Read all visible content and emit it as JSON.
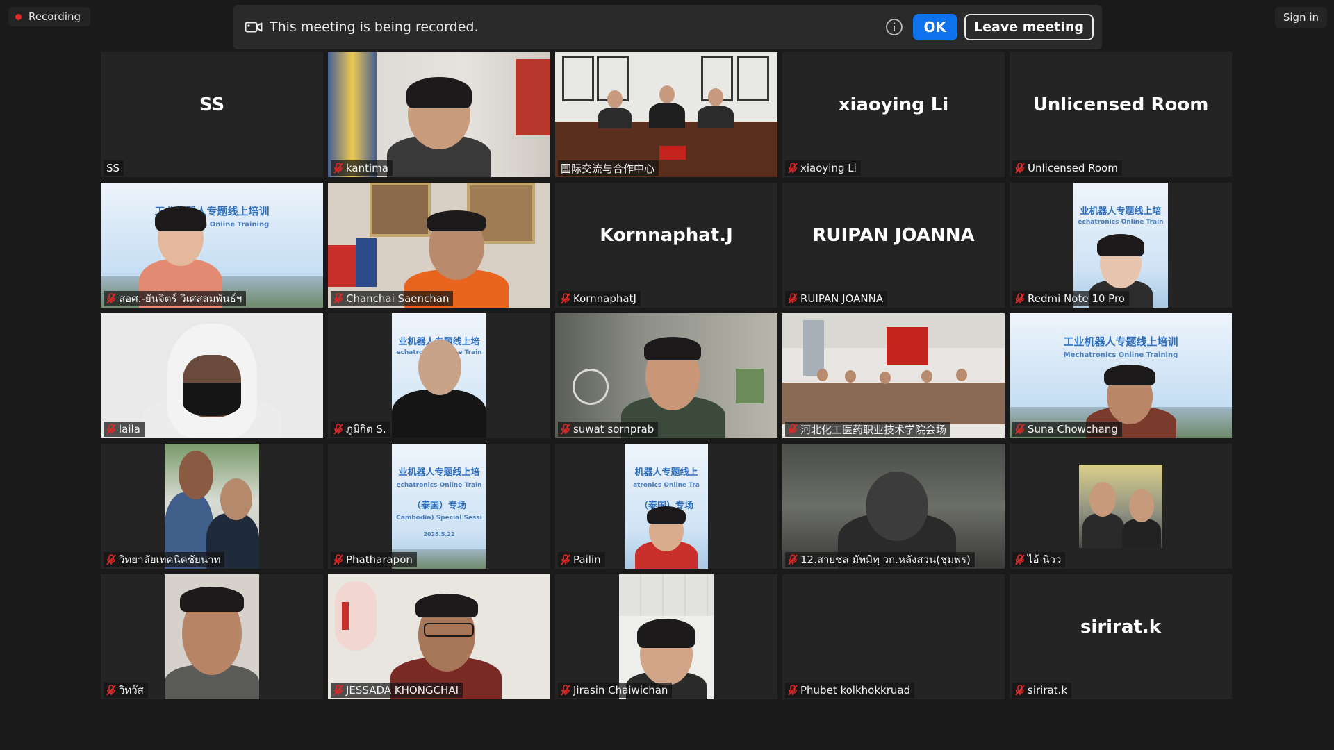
{
  "recording_badge": {
    "label": "Recording",
    "color": "#e02828"
  },
  "sign_in": {
    "label": "Sign in"
  },
  "banner": {
    "message": "This meeting is being recorded.",
    "ok_label": "OK",
    "leave_label": "Leave meeting",
    "ok_color": "#0e72ed"
  },
  "active_speaker_color": "#d6e35b",
  "participants": [
    {
      "name": "SS",
      "initials": "SS",
      "video": false,
      "muted": false
    },
    {
      "name": "kantima",
      "video": true,
      "muted": true
    },
    {
      "name": "国际交流与合作中心",
      "video": true,
      "muted": false,
      "active": true
    },
    {
      "name": "xiaoying Li",
      "initials": "xiaoying Li",
      "video": false,
      "muted": true
    },
    {
      "name": "Unlicensed Room",
      "initials": "Unlicensed Room",
      "video": false,
      "muted": true
    },
    {
      "name": "สอศ.-ยันจิตร์ วิเศสสมพันธ์ฯ",
      "video": true,
      "muted": true
    },
    {
      "name": "Chanchai Saenchan",
      "video": true,
      "muted": true
    },
    {
      "name": "KornnaphatJ",
      "initials": "Kornnaphat.J",
      "video": false,
      "muted": true
    },
    {
      "name": "RUIPAN JOANNA",
      "initials": "RUIPAN JOANNA",
      "video": false,
      "muted": true
    },
    {
      "name": "Redmi Note 10 Pro",
      "video": true,
      "muted": true
    },
    {
      "name": "laila",
      "video": true,
      "muted": true
    },
    {
      "name": "ภูมิกิต S.",
      "video": true,
      "muted": true
    },
    {
      "name": "suwat sornprab",
      "video": true,
      "muted": true
    },
    {
      "name": "河北化工医药职业技术学院会场",
      "video": true,
      "muted": true
    },
    {
      "name": "Suna Chowchang",
      "video": true,
      "muted": true
    },
    {
      "name": "วิทยาลัยเทคนิคชัยนาท",
      "video": true,
      "muted": true
    },
    {
      "name": "Phatharapon",
      "video": true,
      "muted": true
    },
    {
      "name": "Pailin",
      "video": true,
      "muted": true
    },
    {
      "name": "12.สายชล มัทมิทฺ วก.หลังสวน(ชุมพร)",
      "video": true,
      "muted": true
    },
    {
      "name": "ไอ้ นิวว",
      "video": true,
      "muted": true
    },
    {
      "name": "วิทวัส",
      "video": true,
      "muted": true
    },
    {
      "name": "JESSADA  KHONGCHAI",
      "video": true,
      "muted": true
    },
    {
      "name": "Jirasin Chaiwichan",
      "video": true,
      "muted": true
    },
    {
      "name": "Phubet kolkhokkruad",
      "video": false,
      "muted": true
    },
    {
      "name": "sirirat.k",
      "initials": "sirirat.k",
      "video": false,
      "muted": true
    }
  ],
  "promo": {
    "title": "工业机器人专题线上培训",
    "subtitle": "Mechatronics Online Training",
    "line3": "（泰国）专场",
    "line4": "(Cambodia) Special Session",
    "date": "2025.5.22"
  },
  "icons": {
    "recording": "record-dot-icon",
    "camera": "video-camera-icon",
    "info": "info-icon",
    "muted": "mic-muted-icon"
  }
}
